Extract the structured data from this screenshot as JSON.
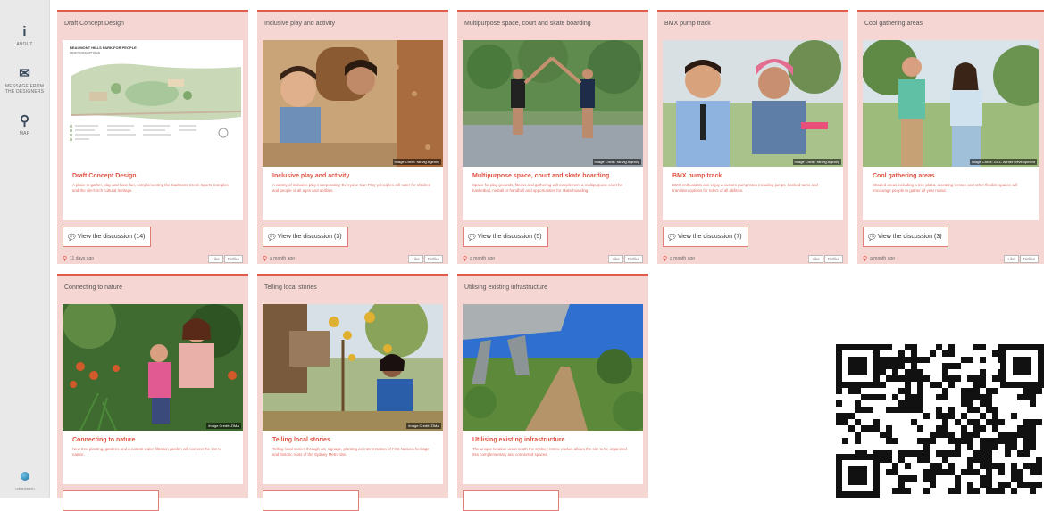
{
  "sidebar": {
    "items": [
      {
        "icon": "info-icon",
        "glyph": "i",
        "label": "About"
      },
      {
        "icon": "envelope-icon",
        "glyph": "✉",
        "label": "Message from the designers"
      },
      {
        "icon": "map-pin-icon",
        "glyph": "⚲",
        "label": "Map"
      }
    ],
    "logo_text": "urbanbeach"
  },
  "cards": [
    {
      "title": "Draft Concept Design",
      "heading": "Draft Concept Design",
      "description": "A place to gather, play and have fun, complementing the Cadmans Creek Sports Complex and the site's rich cultural heritage.",
      "discussion": "View the discussion (14)",
      "date": "11 days ago",
      "like": "Like",
      "dislike": "Dislike",
      "credit": ""
    },
    {
      "title": "Inclusive play and activity",
      "heading": "Inclusive play and activity",
      "description": "A variety of inclusive play incorporating 'Everyone Can Play' principles will cater for children and people of all ages and abilities.",
      "discussion": "View the discussion (3)",
      "date": "a month ago",
      "like": "Like",
      "dislike": "Dislike",
      "credit": "Image Credit: Ninvig Agency"
    },
    {
      "title": "Multipurpose space, court and skate boarding",
      "heading": "Multipurpose space, court and skate boarding",
      "description": "Space for play grounds, fitness and gathering will complement a multipurpose court for basketball, netball or handball and opportunities for skate boarding.",
      "discussion": "View the discussion (5)",
      "date": "a month ago",
      "like": "Like",
      "dislike": "Dislike",
      "credit": "Image Credit: Ninvig Agency"
    },
    {
      "title": "BMX pump track",
      "heading": "BMX pump track",
      "description": "BMX enthusiasts can enjoy a custom pump track including jumps, banked turns and transition options for riders of all abilities.",
      "discussion": "View the discussion (7)",
      "date": "a month ago",
      "like": "Like",
      "dislike": "Dislike",
      "credit": "Image Credit: Ninvig Agency"
    },
    {
      "title": "Cool gathering areas",
      "heading": "Cool gathering areas",
      "description": "Shaded areas including a tree plaza, a seating terrace and other flexible spaces will encourage people to gather all year round.",
      "discussion": "View the discussion (3)",
      "date": "a month ago",
      "like": "Like",
      "dislike": "Dislike",
      "credit": "Image Credit: GCC Winter Development"
    },
    {
      "title": "Connecting to nature",
      "heading": "Connecting to nature",
      "description": "New tree planting, gardens and a natural water filtration garden will connect the site to nature.",
      "discussion": "",
      "date": "",
      "like": "",
      "dislike": "",
      "credit": "Image Credit: ZIMA"
    },
    {
      "title": "Telling local stories",
      "heading": "Telling local stories",
      "description": "Telling local stories through art, signage, planting an interpretation of First Nations heritage and historic roots of the Sydney Metro site.",
      "discussion": "",
      "date": "",
      "like": "",
      "dislike": "",
      "credit": "Image Credit: ZIMA"
    },
    {
      "title": "Utilising existing infrastructure",
      "heading": "Utilising existing infrastructure",
      "description": "The unique location underneath the Sydney Metro viaduct allows the site to be organised into complementary and connected spaces.",
      "discussion": "",
      "date": "",
      "like": "",
      "dislike": "",
      "credit": ""
    }
  ],
  "concept_plan": {
    "heading": "BEAUMONT HILLS PARK FOR PEOPLE",
    "subheading": "DRAFT CONCEPT PLAN"
  },
  "colors": {
    "accent": "#e35a4f",
    "card_bg": "#f6d6d3",
    "link_red": "#e05043"
  }
}
